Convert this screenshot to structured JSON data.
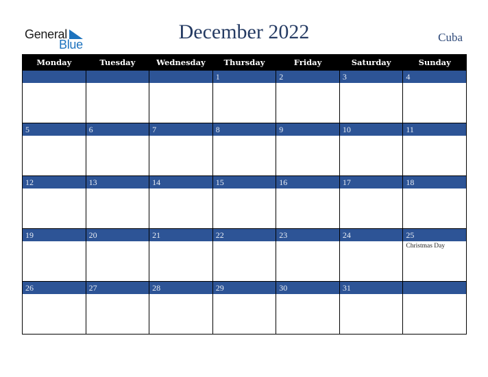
{
  "logo": {
    "line1": "General",
    "line2": "Blue"
  },
  "header": {
    "title": "December 2022",
    "country": "Cuba"
  },
  "colors": {
    "date_bar": "#2d5496",
    "header_bg": "#000000",
    "title": "#253b63",
    "logo_blue": "#1e73be"
  },
  "calendar": {
    "weekdays": [
      "Monday",
      "Tuesday",
      "Wednesday",
      "Thursday",
      "Friday",
      "Saturday",
      "Sunday"
    ],
    "weeks": [
      [
        {
          "day": ""
        },
        {
          "day": ""
        },
        {
          "day": ""
        },
        {
          "day": "1"
        },
        {
          "day": "2"
        },
        {
          "day": "3"
        },
        {
          "day": "4"
        }
      ],
      [
        {
          "day": "5"
        },
        {
          "day": "6"
        },
        {
          "day": "7"
        },
        {
          "day": "8"
        },
        {
          "day": "9"
        },
        {
          "day": "10"
        },
        {
          "day": "11"
        }
      ],
      [
        {
          "day": "12"
        },
        {
          "day": "13"
        },
        {
          "day": "14"
        },
        {
          "day": "15"
        },
        {
          "day": "16"
        },
        {
          "day": "17"
        },
        {
          "day": "18"
        }
      ],
      [
        {
          "day": "19"
        },
        {
          "day": "20"
        },
        {
          "day": "21"
        },
        {
          "day": "22"
        },
        {
          "day": "23"
        },
        {
          "day": "24"
        },
        {
          "day": "25",
          "event": "Christmas Day"
        }
      ],
      [
        {
          "day": "26"
        },
        {
          "day": "27"
        },
        {
          "day": "28"
        },
        {
          "day": "29"
        },
        {
          "day": "30"
        },
        {
          "day": "31"
        },
        {
          "day": ""
        }
      ]
    ]
  }
}
